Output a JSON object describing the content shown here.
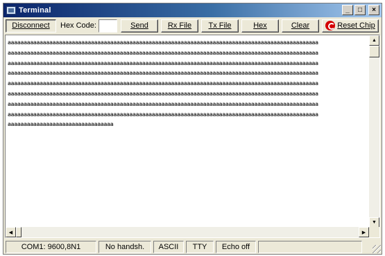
{
  "window": {
    "title": "Terminal",
    "controls": {
      "minimize": "_",
      "maximize": "□",
      "close": "×"
    }
  },
  "toolbar": {
    "disconnect_label": "Disconnect",
    "hex_code_label": "Hex Code:",
    "hex_code_value": "",
    "send_label": "Send",
    "rx_file_label": "Rx File",
    "tx_file_label": "Tx File",
    "hex_label": "Hex",
    "clear_label": "Clear",
    "reset_chip_label": "Reset Chip"
  },
  "terminal": {
    "text": "aaaaaaaaaaaaaaaaaaaaaaaaaaaaaaaaaaaaaaaaaaaaaaaaaaaaaaaaaaaaaaaaaaaaaaaaaaaaaaaaaaaaaaaaaaaaaaaaa\naaaaaaaaaaaaaaaaaaaaaaaaaaaaaaaaaaaaaaaaaaaaaaaaaaaaaaaaaaaaaaaaaaaaaaaaaaaaaaaaaaaaaaaaaaaaaaaaa\naaaaaaaaaaaaaaaaaaaaaaaaaaaaaaaaaaaaaaaaaaaaaaaaaaaaaaaaaaaaaaaaaaaaaaaaaaaaaaaaaaaaaaaaaaaaaaaaa\naaaaaaaaaaaaaaaaaaaaaaaaaaaaaaaaaaaaaaaaaaaaaaaaaaaaaaaaaaaaaaaaaaaaaaaaaaaaaaaaaaaaaaaaaaaaaaaaa\naaaaaaaaaaaaaaaaaaaaaaaaaaaaaaaaaaaaaaaaaaaaaaaaaaaaaaaaaaaaaaaaaaaaaaaaaaaaaaaaaaaaaaaaaaaaaaaaa\naaaaaaaaaaaaaaaaaaaaaaaaaaaaaaaaaaaaaaaaaaaaaaaaaaaaaaaaaaaaaaaaaaaaaaaaaaaaaaaaaaaaaaaaaaaaaaaaa\naaaaaaaaaaaaaaaaaaaaaaaaaaaaaaaaaaaaaaaaaaaaaaaaaaaaaaaaaaaaaaaaaaaaaaaaaaaaaaaaaaaaaaaaaaaaaaaaa\naaaaaaaaaaaaaaaaaaaaaaaaaaaaaaaaaaaaaaaaaaaaaaaaaaaaaaaaaaaaaaaaaaaaaaaaaaaaaaaaaaaaaaaaaaaaaaaaa\naaaaaaaaaaaaaaaaaaaaaaaaaaaaaaaaa"
  },
  "statusbar": {
    "port": "COM1: 9600,8N1",
    "handshake": "No handsh.",
    "mode": "ASCII",
    "terminal_type": "TTY",
    "echo": "Echo off",
    "extra": ""
  },
  "colors": {
    "titlebar_start": "#0a246a",
    "titlebar_end": "#a6caf0",
    "face": "#ece9d8",
    "reset_icon": "#d40000"
  }
}
